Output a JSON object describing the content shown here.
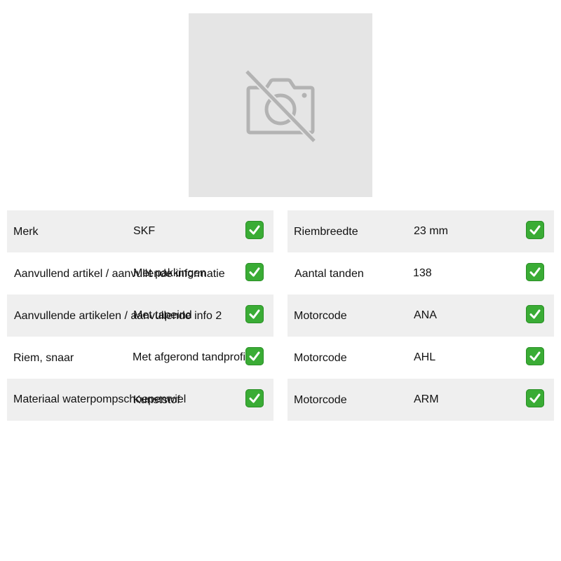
{
  "image": {
    "icon": "no-photo-icon"
  },
  "left_specs": [
    {
      "label": "Merk",
      "value": "SKF",
      "status_icon": "check-mark-icon"
    },
    {
      "label": "Aanvullend artikel / aanvullende informatie",
      "value": "Met pakkingen",
      "status_icon": "check-mark-icon"
    },
    {
      "label": "Aanvullende artikelen / aanvullende info 2",
      "value": "Met tapeind",
      "status_icon": "check-mark-icon"
    },
    {
      "label": "Riem, snaar",
      "value": "Met afgerond tandprofiel",
      "status_icon": "check-mark-icon"
    },
    {
      "label": "Materiaal waterpompschoepenwiel",
      "value": "Kunststof",
      "status_icon": "check-mark-icon"
    }
  ],
  "right_specs": [
    {
      "label": "Riembreedte",
      "value": "23 mm",
      "status_icon": "check-mark-icon"
    },
    {
      "label": "Aantal tanden",
      "value": "138",
      "status_icon": "check-mark-icon"
    },
    {
      "label": "Motorcode",
      "value": "ANA",
      "status_icon": "check-mark-icon"
    },
    {
      "label": "Motorcode",
      "value": "AHL",
      "status_icon": "check-mark-icon"
    },
    {
      "label": "Motorcode",
      "value": "ARM",
      "status_icon": "check-mark-icon"
    }
  ],
  "colors": {
    "row_shade": "#efefef",
    "check_green": "#3aac35",
    "placeholder_bg": "#e5e5e5",
    "placeholder_icon": "#b3b3b3"
  }
}
